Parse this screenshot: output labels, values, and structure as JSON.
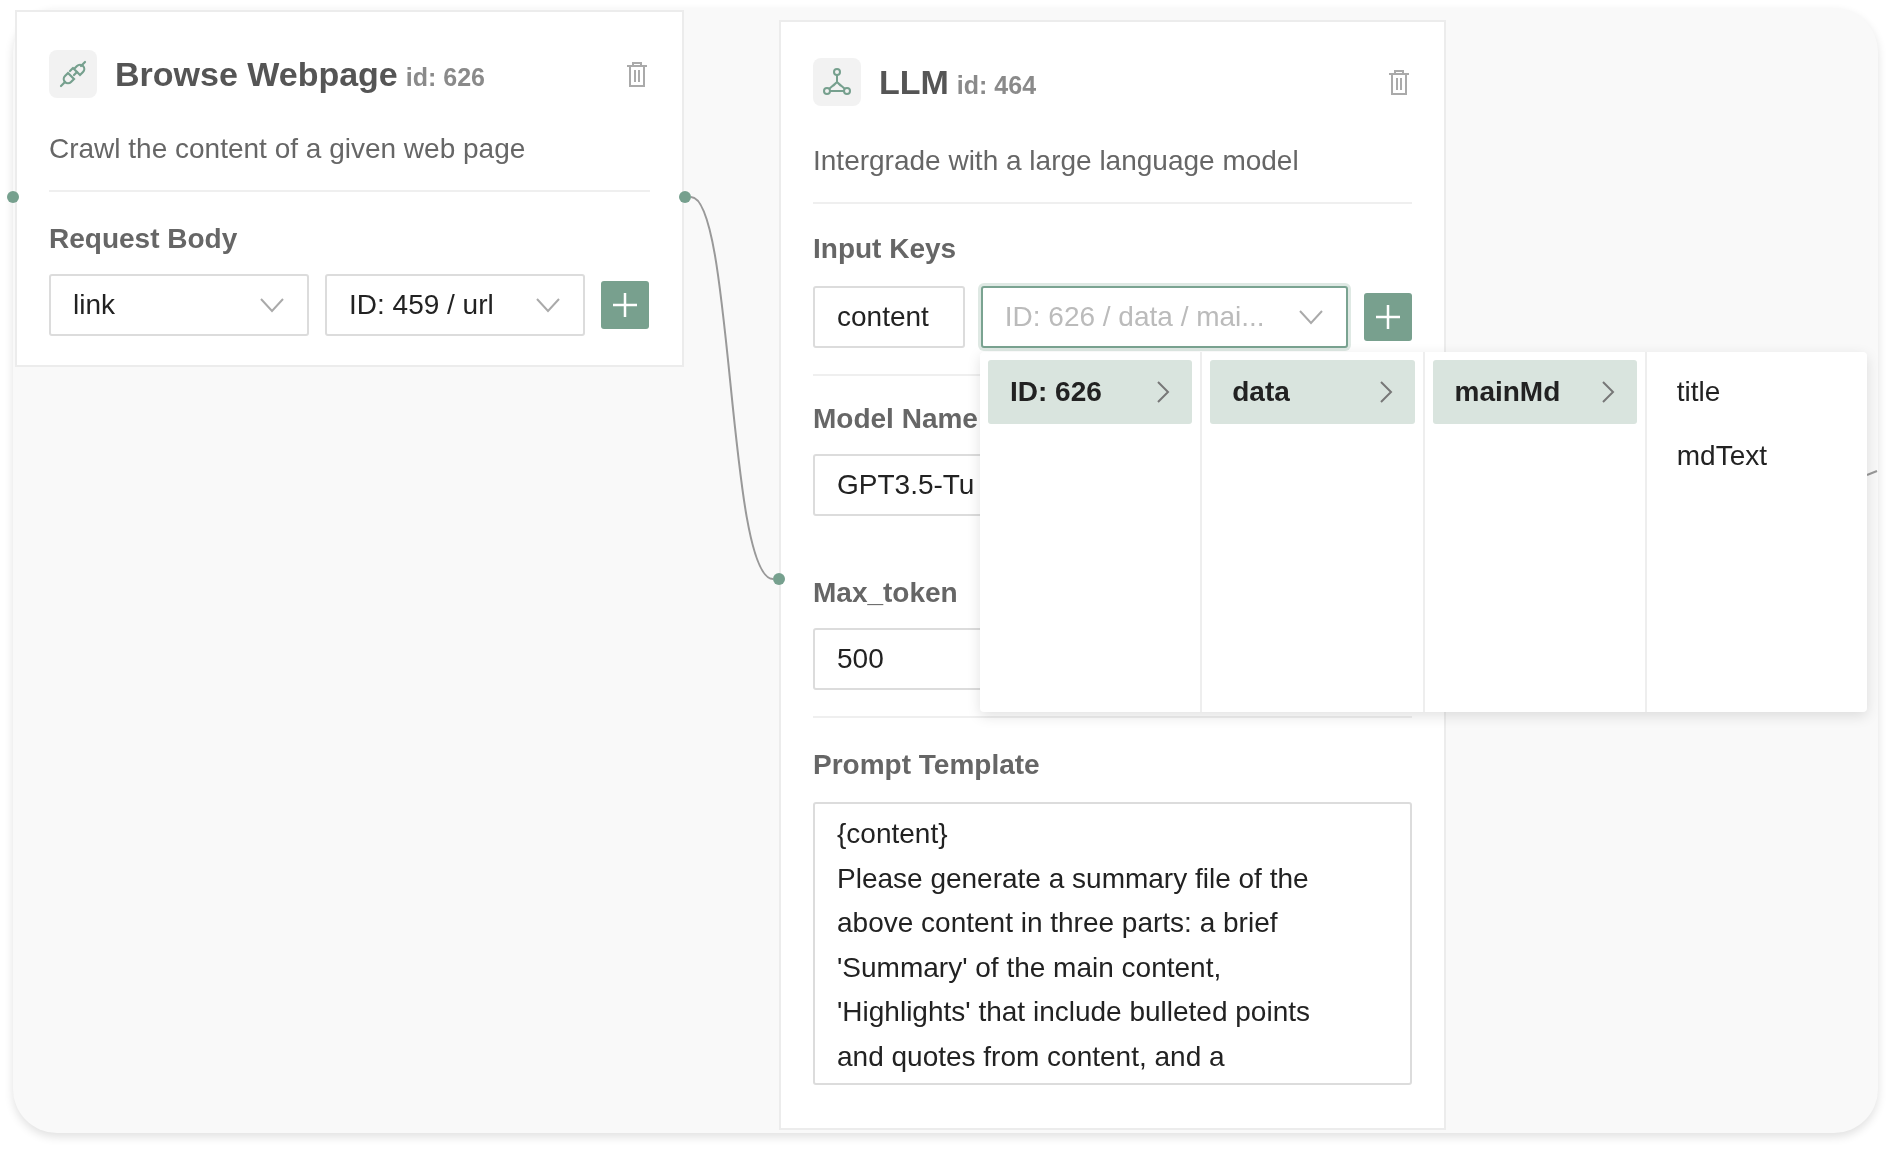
{
  "browse_node": {
    "title": "Browse Webpage",
    "id_text": "id: 626",
    "description": "Crawl the content of a given web page",
    "request_body": {
      "label": "Request Body",
      "key": "link",
      "value": "ID: 459 / url"
    }
  },
  "llm_node": {
    "title": "LLM",
    "id_text": "id: 464",
    "description": "Intergrade with a large language model",
    "input_keys": {
      "label": "Input Keys",
      "key": "content",
      "placeholder": "ID: 626 / data / mai..."
    },
    "model_name": {
      "label": "Model Name",
      "value": "GPT3.5-Tu"
    },
    "max_token": {
      "label": "Max_token",
      "value": "500"
    },
    "prompt_template": {
      "label": "Prompt Template",
      "value": "{content}\nPlease generate a summary file of the\nabove content in three parts: a brief\n'Summary' of the main content,\n'Highlights' that include bulleted points\nand quotes from content, and a"
    }
  },
  "cascader": {
    "columns": [
      {
        "items": [
          {
            "label": "ID: 626",
            "selected": true,
            "has_children": true
          }
        ]
      },
      {
        "items": [
          {
            "label": "data",
            "selected": true,
            "has_children": true
          }
        ]
      },
      {
        "items": [
          {
            "label": "mainMd",
            "selected": true,
            "has_children": true
          }
        ]
      },
      {
        "items": [
          {
            "label": "title",
            "selected": false,
            "has_children": false
          },
          {
            "label": "mdText",
            "selected": false,
            "has_children": false
          }
        ]
      }
    ]
  }
}
